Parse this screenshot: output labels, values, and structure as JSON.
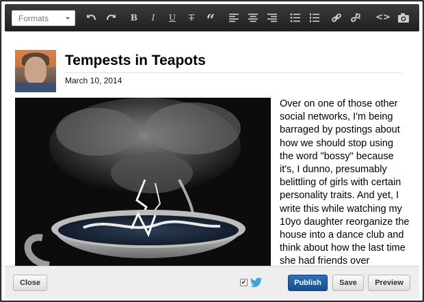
{
  "toolbar": {
    "formats_label": "Formats",
    "buttons": [
      {
        "name": "undo-icon"
      },
      {
        "name": "redo-icon"
      },
      {
        "name": "bold-icon",
        "glyph": "B"
      },
      {
        "name": "italic-icon",
        "glyph": "I"
      },
      {
        "name": "underline-icon",
        "glyph": "U"
      },
      {
        "name": "strikethrough-icon",
        "glyph": "T"
      },
      {
        "name": "blockquote-icon",
        "glyph": "“"
      },
      {
        "name": "align-left-icon"
      },
      {
        "name": "align-center-icon"
      },
      {
        "name": "align-right-icon"
      },
      {
        "name": "bullet-list-icon"
      },
      {
        "name": "numbered-list-icon"
      },
      {
        "name": "link-icon"
      },
      {
        "name": "unlink-icon"
      },
      {
        "name": "code-icon",
        "glyph": "<>"
      },
      {
        "name": "camera-icon"
      }
    ]
  },
  "post": {
    "title": "Tempests in Teapots",
    "date": "March 10, 2014",
    "image_icon": "teacup-storm-image",
    "body": "Over on one of those other social networks, I'm being barraged by postings about how we should stop using the word \"bossy\" because it's, I dunno, presumably belittling of girls with certain personality traits. And yet, I write this while watching my 10yo daughter reorganize the house into a dance club and think about how the last time she had friends over"
  },
  "footer": {
    "close_label": "Close",
    "twitter_checked": true,
    "publish_label": "Publish",
    "save_label": "Save",
    "preview_label": "Preview"
  },
  "colors": {
    "toolbar_bg": "#2b2b2b",
    "publish_bg": "#1f5ea6",
    "twitter_blue": "#3aa5df"
  }
}
